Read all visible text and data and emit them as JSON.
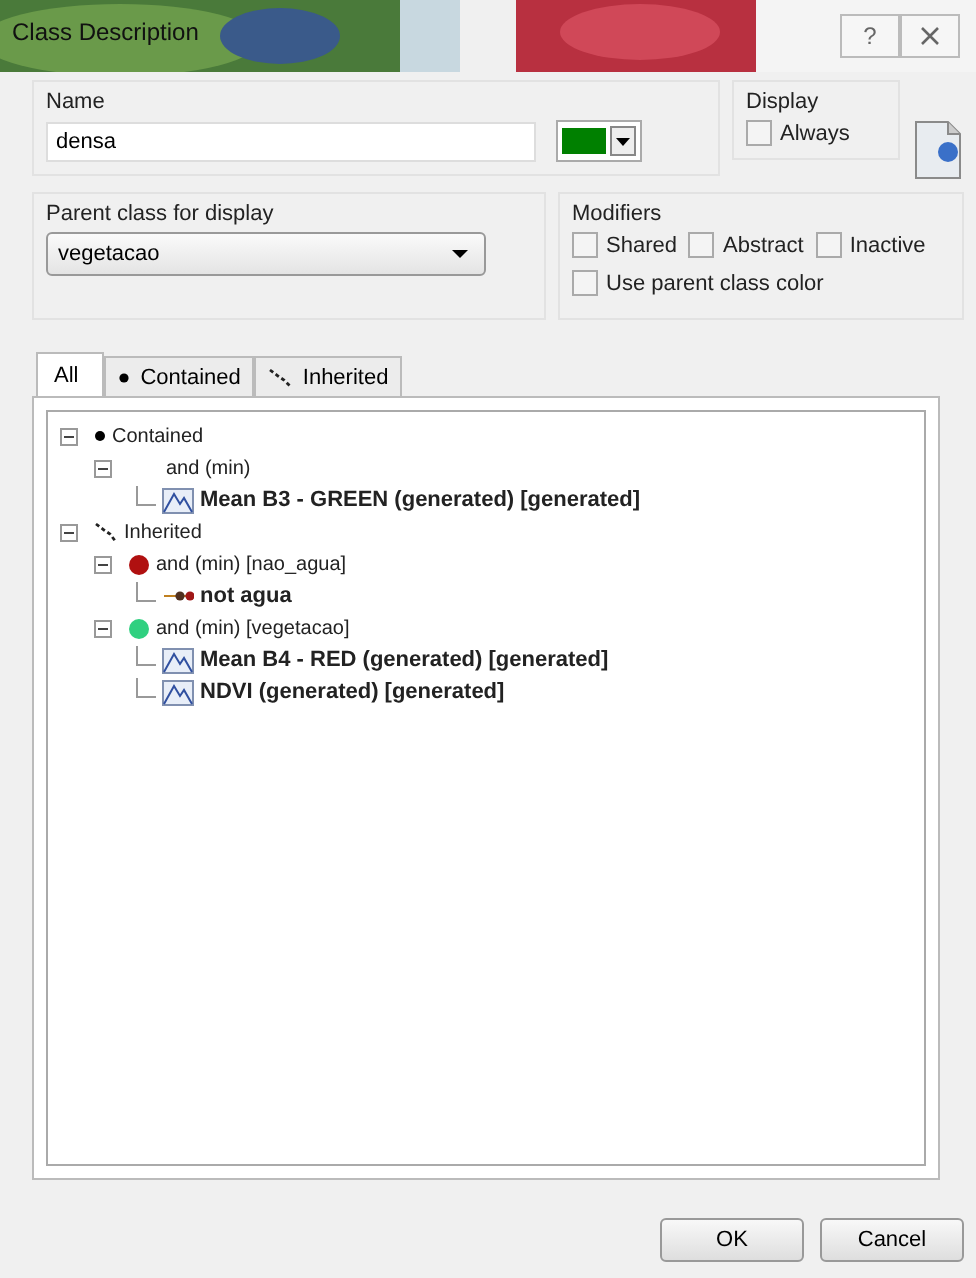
{
  "window": {
    "title": "Class Description",
    "help": "?"
  },
  "name": {
    "label": "Name",
    "value": "densa",
    "color": "#008000"
  },
  "display": {
    "label": "Display",
    "always": {
      "label": "Always",
      "checked": false
    }
  },
  "parent": {
    "label": "Parent class for display",
    "value": "vegetacao"
  },
  "modifiers": {
    "label": "Modifiers",
    "options": [
      {
        "label": "Shared",
        "checked": false
      },
      {
        "label": "Abstract",
        "checked": false
      },
      {
        "label": "Inactive",
        "checked": false
      },
      {
        "label": "Use parent class color",
        "checked": false
      }
    ]
  },
  "tabs": [
    {
      "label": "All",
      "kind": "none",
      "selected": true
    },
    {
      "label": "Contained",
      "kind": "dot",
      "selected": false
    },
    {
      "label": "Inherited",
      "kind": "inherited",
      "selected": false
    }
  ],
  "tree": [
    {
      "label": "Contained",
      "kind": "dot",
      "bold": false,
      "expanded": true,
      "children": [
        {
          "label": "and (min)",
          "kind": "blank",
          "bold": false,
          "expanded": true,
          "children": [
            {
              "label": "Mean B3 - GREEN (generated) [generated]",
              "kind": "feature",
              "bold": true
            }
          ]
        }
      ]
    },
    {
      "label": "Inherited",
      "kind": "inherited",
      "bold": false,
      "expanded": true,
      "children": [
        {
          "label": "and (min) [nao_agua]",
          "kind": "circle",
          "color": "#b01010",
          "bold": false,
          "expanded": true,
          "children": [
            {
              "label": "not agua",
              "kind": "not",
              "bold": true
            }
          ]
        },
        {
          "label": "and (min) [vegetacao]",
          "kind": "circle",
          "color": "#30d080",
          "bold": false,
          "expanded": true,
          "children": [
            {
              "label": "Mean B4 - RED (generated) [generated]",
              "kind": "feature",
              "bold": true
            },
            {
              "label": "NDVI (generated) [generated]",
              "kind": "feature",
              "bold": true
            }
          ]
        }
      ]
    }
  ],
  "buttons": [
    "OK",
    "Cancel"
  ]
}
